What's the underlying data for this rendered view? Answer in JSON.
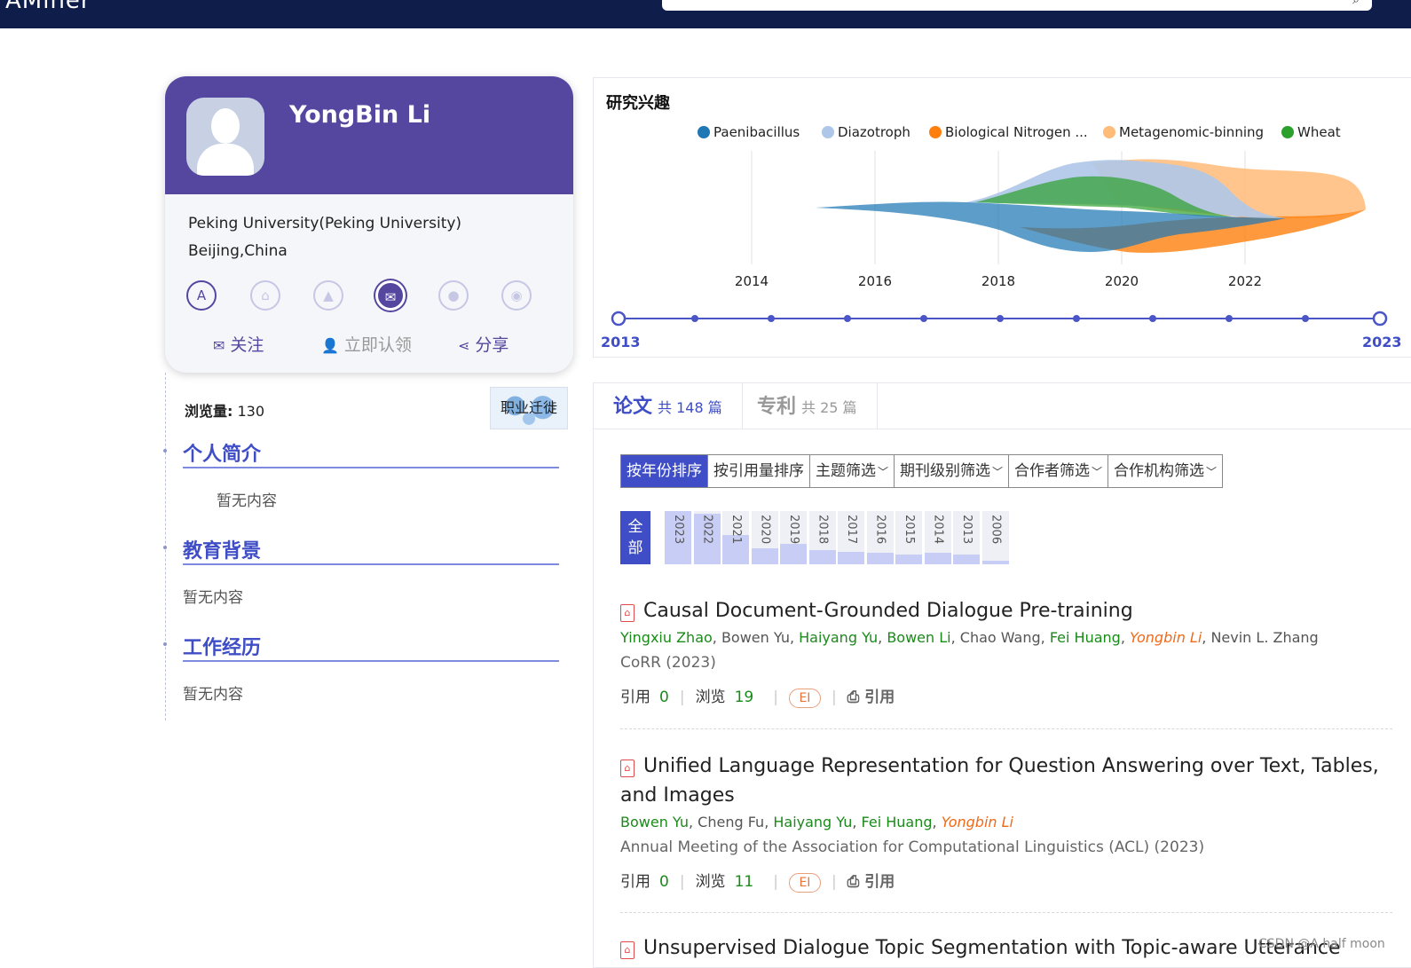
{
  "app": {
    "logo": "AMiner",
    "search_icon": "search-icon"
  },
  "profile": {
    "name": "YongBin Li",
    "organization": "Peking University(Peking University)",
    "location": "Beijing,China",
    "icons": [
      "aminer-icon",
      "home-icon",
      "education-icon",
      "email-icon",
      "location-icon",
      "weibo-icon"
    ],
    "actions": {
      "follow": "关注",
      "claim": "立即认领",
      "share": "分享"
    },
    "views_label": "浏览量:",
    "views_count": "130",
    "career_button": "职业迁徙"
  },
  "sections": {
    "bio": {
      "title": "个人简介",
      "content": "暂无内容"
    },
    "education": {
      "title": "教育背景",
      "content": "暂无内容"
    },
    "work": {
      "title": "工作经历",
      "content": "暂无内容"
    }
  },
  "interests": {
    "title": "研究兴趣",
    "legend": [
      {
        "label": "Paenibacillus",
        "color": "#1f77b4"
      },
      {
        "label": "Diazotroph",
        "color": "#aec7e8"
      },
      {
        "label": "Biological Nitrogen ...",
        "color": "#ff7f0e"
      },
      {
        "label": "Metagenomic-binning",
        "color": "#ffbb78"
      },
      {
        "label": "Wheat",
        "color": "#2ca02c"
      }
    ],
    "axis_years": [
      "2014",
      "2016",
      "2018",
      "2020",
      "2022"
    ],
    "timeline_start": "2013",
    "timeline_end": "2023"
  },
  "papers": {
    "tabs": [
      {
        "label": "论文",
        "count": "共 148 篇"
      },
      {
        "label": "专利",
        "count": "共 25 篇"
      }
    ],
    "sort_options": [
      "按年份排序",
      "按引用量排序",
      "主题筛选",
      "期刊级别筛选",
      "合作者筛选",
      "合作机构筛选"
    ],
    "year_all": "全部",
    "years": [
      {
        "year": "2023",
        "level": 1.0
      },
      {
        "year": "2022",
        "level": 0.95
      },
      {
        "year": "2021",
        "level": 0.55
      },
      {
        "year": "2020",
        "level": 0.3
      },
      {
        "year": "2019",
        "level": 0.38
      },
      {
        "year": "2018",
        "level": 0.26
      },
      {
        "year": "2017",
        "level": 0.24
      },
      {
        "year": "2016",
        "level": 0.22
      },
      {
        "year": "2015",
        "level": 0.18
      },
      {
        "year": "2014",
        "level": 0.22
      },
      {
        "year": "2013",
        "level": 0.18
      },
      {
        "year": "2006",
        "level": 0.06
      }
    ],
    "items": [
      {
        "title": "Causal Document-Grounded Dialogue Pre-training",
        "authors": [
          {
            "name": "Yingxiu Zhao",
            "type": "linked"
          },
          {
            "name": "Bowen Yu",
            "type": "plain"
          },
          {
            "name": "Haiyang Yu",
            "type": "linked"
          },
          {
            "name": "Bowen Li",
            "type": "linked"
          },
          {
            "name": "Chao Wang",
            "type": "plain"
          },
          {
            "name": "Fei Huang",
            "type": "linked"
          },
          {
            "name": "Yongbin Li",
            "type": "self"
          },
          {
            "name": "Nevin L. Zhang",
            "type": "plain"
          }
        ],
        "venue": "CoRR (2023)",
        "cite_label": "引用",
        "cite_count": "0",
        "view_label": "浏览",
        "view_count": "19",
        "badge": "EI",
        "cite_button": "引用"
      },
      {
        "title": "Unified Language Representation for Question Answering over Text, Tables, and Images",
        "authors": [
          {
            "name": "Bowen Yu",
            "type": "linked"
          },
          {
            "name": "Cheng Fu",
            "type": "plain"
          },
          {
            "name": "Haiyang Yu",
            "type": "linked"
          },
          {
            "name": "Fei Huang",
            "type": "linked"
          },
          {
            "name": "Yongbin Li",
            "type": "self"
          }
        ],
        "venue": "Annual Meeting of the Association for Computational Linguistics (ACL)  (2023)",
        "cite_label": "引用",
        "cite_count": "0",
        "view_label": "浏览",
        "view_count": "11",
        "badge": "EI",
        "cite_button": "引用"
      },
      {
        "title": "Unsupervised Dialogue Topic Segmentation with Topic-aware Utterance"
      }
    ]
  },
  "watermark": "CSDN @A half moon"
}
